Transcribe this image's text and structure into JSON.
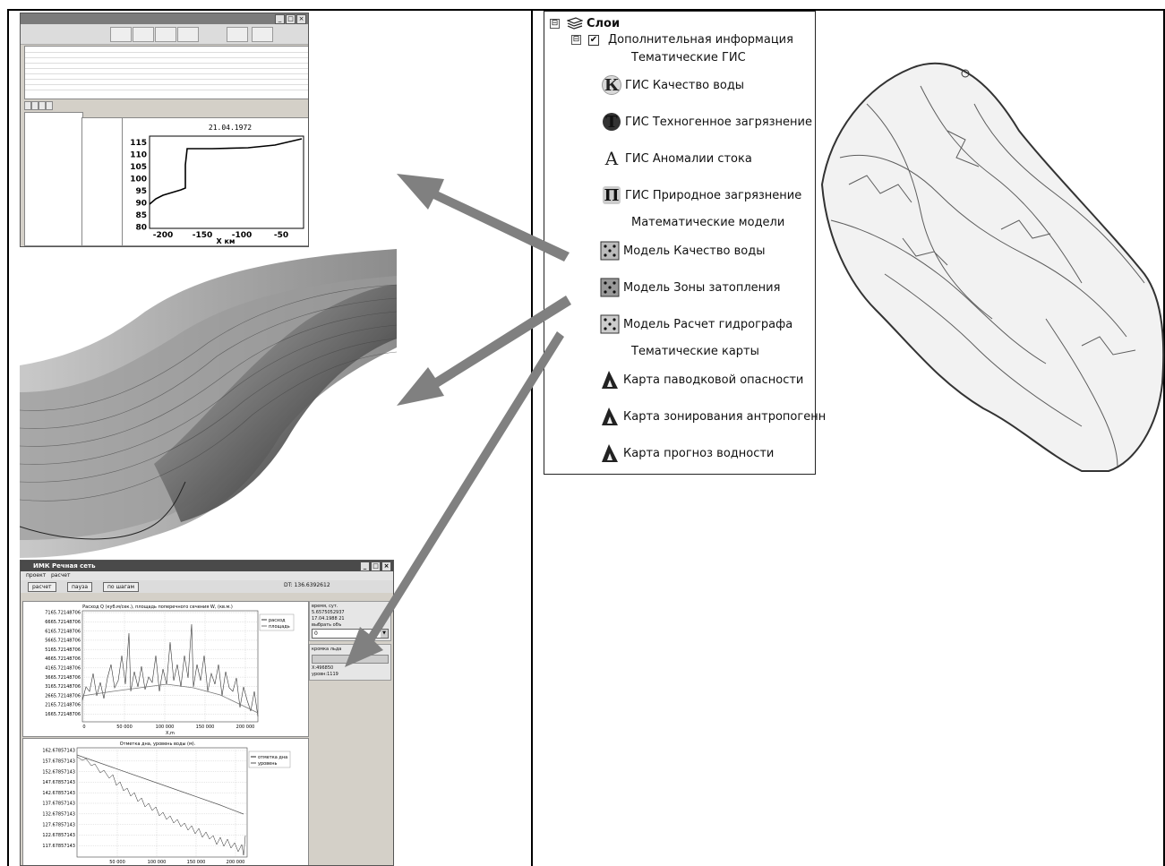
{
  "chart_window": {
    "chart_title": "21.04.1972",
    "x_axis_label": "X км",
    "y_ticks": [
      "115",
      "110",
      "105",
      "100",
      "95",
      "90",
      "85",
      "80"
    ],
    "x_ticks": [
      "-200",
      "-150",
      "-100",
      "-50"
    ]
  },
  "river_window": {
    "title": "ИМК Речная сеть",
    "window_controls": [
      "_",
      "□",
      "×"
    ],
    "menu": [
      "проект",
      "расчет"
    ],
    "buttons": [
      "расчет",
      "пауза",
      "по шагам"
    ],
    "dt_label": "DT: 136.6392612",
    "top_plot": {
      "title": "Расход Q (куб.м/сек.), площадь поперечного сечения W, (кв.м.)",
      "legend": [
        "расход",
        "площадь"
      ],
      "y_ticks": [
        "7165.72148706",
        "6665.72148706",
        "6165.72148706",
        "5665.72148706",
        "5165.72148706",
        "4665.72148706",
        "4165.72148706",
        "3665.72148706",
        "3165.72148706",
        "2665.72148706",
        "2165.72148706",
        "1665.72148706"
      ],
      "x_ticks": [
        "0",
        "50 000",
        "100 000",
        "150 000",
        "200 000"
      ],
      "x_label": "X,m"
    },
    "bottom_plot": {
      "title": "Отметка дна, уровень воды (м).",
      "legend": [
        "отметка дна",
        "уровень"
      ],
      "y_ticks": [
        "162.67857143",
        "157.67857143",
        "152.67857143",
        "147.67857143",
        "142.67857143",
        "137.67857143",
        "132.67857143",
        "127.67857143",
        "122.67857143",
        "117.67857143"
      ],
      "x_ticks": [
        "50 000",
        "100 000",
        "150 000",
        "200 000"
      ]
    },
    "side": {
      "time_label": "время, сут.",
      "time_value": "5.6575052937",
      "date_value": "17.04.1988 21",
      "select_label": "выбрать объ",
      "select_value": "0",
      "section_label": "кромка льда",
      "coord_x": "X:496850",
      "level": "уровн:1119"
    }
  },
  "layers_tree": {
    "root": {
      "label": "Слои",
      "expander": "⊟"
    },
    "group": {
      "label": "Дополнительная информация",
      "expander": "⊟",
      "checked": "✔"
    },
    "sections": [
      {
        "label": "Тематические ГИС"
      },
      {
        "label": "Математические модели"
      },
      {
        "label": "Тематические карты"
      }
    ],
    "gis_items": [
      {
        "letter": "К",
        "label": "ГИС Качество воды"
      },
      {
        "letter": "Т",
        "label": "ГИС Техногенное загрязнение"
      },
      {
        "letter": "А",
        "label": "ГИС Аномалии стока"
      },
      {
        "letter": "П",
        "label": "ГИС Природное загрязнение"
      }
    ],
    "model_items": [
      {
        "label": "Модель Качество воды"
      },
      {
        "label": "Модель Зоны затопления"
      },
      {
        "label": "Модель Расчет гидрографа"
      }
    ],
    "map_items": [
      {
        "label": "Карта паводковой опасности"
      },
      {
        "label": "Карта зонирования антропогенн"
      },
      {
        "label": "Карта прогноз водности"
      }
    ]
  },
  "colors": {
    "arrow": "#808080",
    "panel_border": "#000000",
    "window_bg": "#d4d0c8"
  }
}
